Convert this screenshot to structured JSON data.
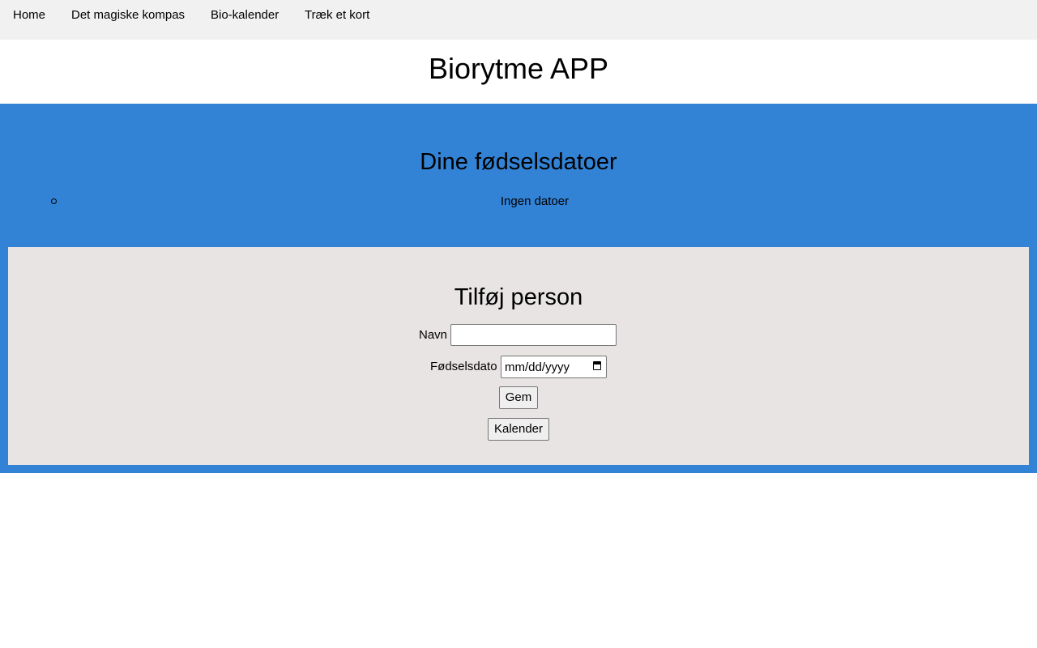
{
  "nav": {
    "items": [
      {
        "label": "Home"
      },
      {
        "label": "Det magiske kompas"
      },
      {
        "label": "Bio-kalender"
      },
      {
        "label": "Træk et kort"
      }
    ]
  },
  "header": {
    "title": "Biorytme APP"
  },
  "dates_section": {
    "heading": "Dine fødselsdatoer",
    "items": [
      "Ingen datoer"
    ]
  },
  "form": {
    "heading": "Tilføj person",
    "name_label": "Navn",
    "name_value": "",
    "birthdate_label": "Fødselsdato",
    "birthdate_placeholder": "mm/dd/yyyy",
    "save_label": "Gem",
    "calendar_label": "Kalender"
  },
  "colors": {
    "nav_background": "#f1f1f1",
    "panel_blue": "#3283d6",
    "form_background": "#e8e4e4"
  },
  "icons": {
    "date_picker": "calendar-icon"
  }
}
